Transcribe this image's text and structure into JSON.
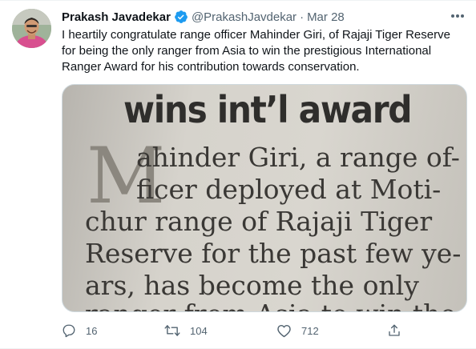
{
  "tweet": {
    "author_name": "Prakash Javadekar",
    "handle": "@PrakashJavdekar",
    "separator": "·",
    "time": "Mar 28",
    "text": "I heartily congratulate range officer Mahinder Giri, of Rajaji Tiger Reserve for being the only ranger from Asia to win the prestigious International Ranger Award for his contribution towards conservation.",
    "text_lines": [
      "I heartily congratulate range officer Mahinder Giri, of Rajaji Tiger Reserve",
      "for being the only ranger from Asia to win the prestigious International",
      "Ranger Award for his contribution towards conservation."
    ]
  },
  "media": {
    "headline": "wins int’l award",
    "dropcap": "M",
    "lines": [
      "ahinder Giri, a range of-",
      "ficer deployed at Moti-",
      "chur range of Rajaji Tiger",
      "Reserve for the past few ye-",
      "ars, has become the only",
      "ranger from Asia to win the"
    ]
  },
  "actions": {
    "replies": "16",
    "retweets": "104",
    "likes": "712"
  },
  "icons": {
    "verified": "verified-badge-icon",
    "more": "more-options-icon",
    "reply": "reply-icon",
    "retweet": "retweet-icon",
    "like": "like-icon",
    "share": "share-icon"
  },
  "colors": {
    "verified_blue": "#1d9bf0",
    "secondary_text": "#536471",
    "primary_text": "#0f1419"
  }
}
